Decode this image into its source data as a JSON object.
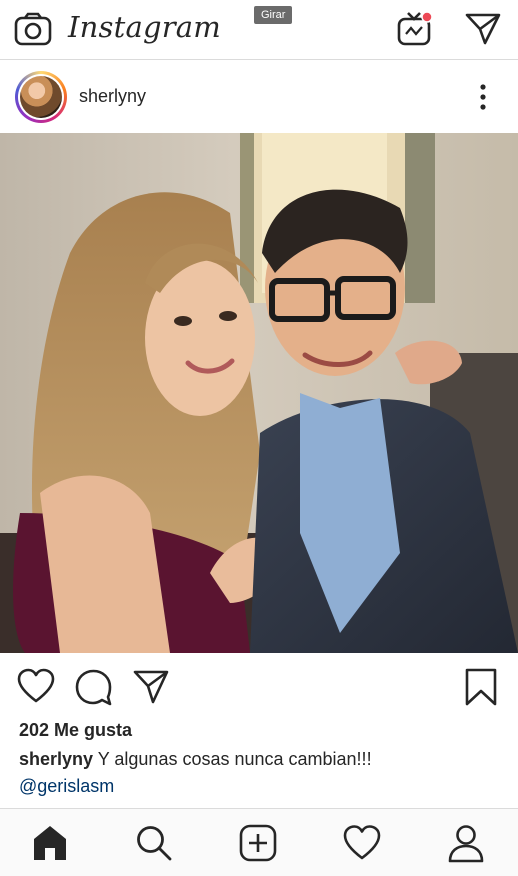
{
  "header": {
    "logo_text": "Instagram",
    "tooltip": "Girar",
    "igtv_badge_color": "#ed4956"
  },
  "post": {
    "username": "sherlyny",
    "likes": "202 Me gusta",
    "caption_user": "sherlyny",
    "caption_text": " Y algunas cosas nunca cambian!!!",
    "mention": "@gerislasm"
  },
  "icons": {
    "top": [
      "camera-icon",
      "igtv-icon",
      "direct-message-icon"
    ],
    "post": [
      "more-options-icon"
    ],
    "actions": [
      "heart-icon",
      "comment-icon",
      "share-icon",
      "bookmark-icon"
    ],
    "tabs": [
      "home-icon",
      "search-icon",
      "new-post-icon",
      "activity-heart-icon",
      "profile-icon"
    ]
  },
  "colors": {
    "text": "#262626",
    "link": "#003569",
    "border": "#dbdbdb"
  }
}
